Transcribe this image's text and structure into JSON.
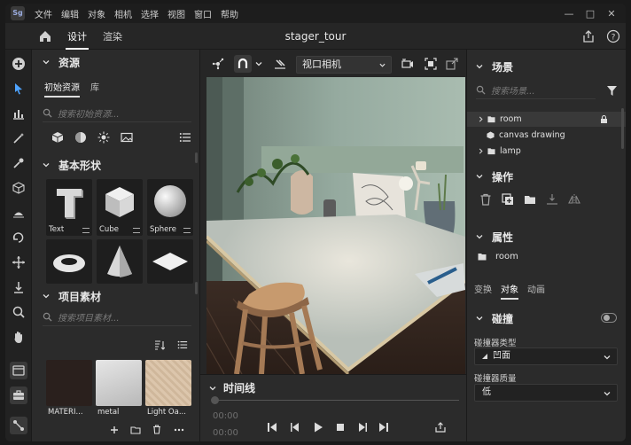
{
  "menubar": {
    "logo": "Sg",
    "items": [
      "文件",
      "编辑",
      "对象",
      "相机",
      "选择",
      "视图",
      "窗口",
      "帮助"
    ],
    "window_controls": [
      "minimize-icon",
      "maximize-icon",
      "close-icon"
    ]
  },
  "tabbar": {
    "tabs": [
      {
        "label": "设计",
        "active": true
      },
      {
        "label": "渲染",
        "active": false
      }
    ],
    "document_title": "stager_tour",
    "right_icons": [
      "share-icon",
      "help-icon"
    ]
  },
  "left_toolbar": {
    "tools": [
      "add-icon",
      "select-arrow-icon",
      "chart-icon",
      "magic-wand-icon",
      "eyedropper-icon",
      "cube-icon",
      "light-icon",
      "orbit-icon",
      "move-icon",
      "drop-icon",
      "zoom-icon",
      "hand-icon",
      "panel-toggle-icon",
      "briefcase-icon",
      "connect-icon"
    ]
  },
  "assets": {
    "title": "资源",
    "tabs": [
      {
        "label": "初始资源",
        "active": true
      },
      {
        "label": "库",
        "active": false
      }
    ],
    "search_placeholder": "搜索初始资源...",
    "filter_icons": [
      "cube-filled-icon",
      "sphere-icon",
      "sun-icon",
      "image-icon",
      "list-icon"
    ]
  },
  "shapes": {
    "title": "基本形状",
    "items": [
      {
        "label": "Text"
      },
      {
        "label": "Cube"
      },
      {
        "label": "Sphere"
      },
      {
        "label": ""
      },
      {
        "label": ""
      },
      {
        "label": ""
      }
    ]
  },
  "project_materials": {
    "title": "项目素材",
    "search_placeholder": "搜索项目素材...",
    "items": [
      {
        "label": "MATERI...",
        "color": "#2a201d"
      },
      {
        "label": "metal",
        "color": "#c9c9c9"
      },
      {
        "label": "Light Oa...",
        "color": "#d9c2a8"
      }
    ],
    "footer_icons": [
      "add-icon",
      "folder-icon",
      "trash-icon",
      "more-icon"
    ]
  },
  "viewport_toolbar": {
    "camera_label": "视口相机"
  },
  "timeline": {
    "title": "时间线",
    "current_time": "00:00",
    "total_time": "00:00"
  },
  "scene": {
    "title": "场景",
    "search_placeholder": "搜索场景...",
    "tree": [
      {
        "label": "room",
        "selected": true,
        "type": "folder",
        "locked": true
      },
      {
        "label": "canvas drawing",
        "selected": false,
        "type": "object",
        "locked": false
      },
      {
        "label": "lamp",
        "selected": false,
        "type": "folder",
        "locked": false
      }
    ]
  },
  "operations": {
    "title": "操作"
  },
  "properties": {
    "title": "属性",
    "object_name": "room",
    "tabs": [
      {
        "label": "变换",
        "active": false
      },
      {
        "label": "对象",
        "active": true
      },
      {
        "label": "动画",
        "active": false
      }
    ],
    "collision": {
      "title": "碰撞",
      "type_label": "碰撞器类型",
      "type_value": "凹面",
      "quality_label": "碰撞器质量",
      "quality_value": "低"
    }
  },
  "colors": {
    "panel": "#2b2b2b",
    "background": "#262626",
    "accent": "#ffffff"
  }
}
